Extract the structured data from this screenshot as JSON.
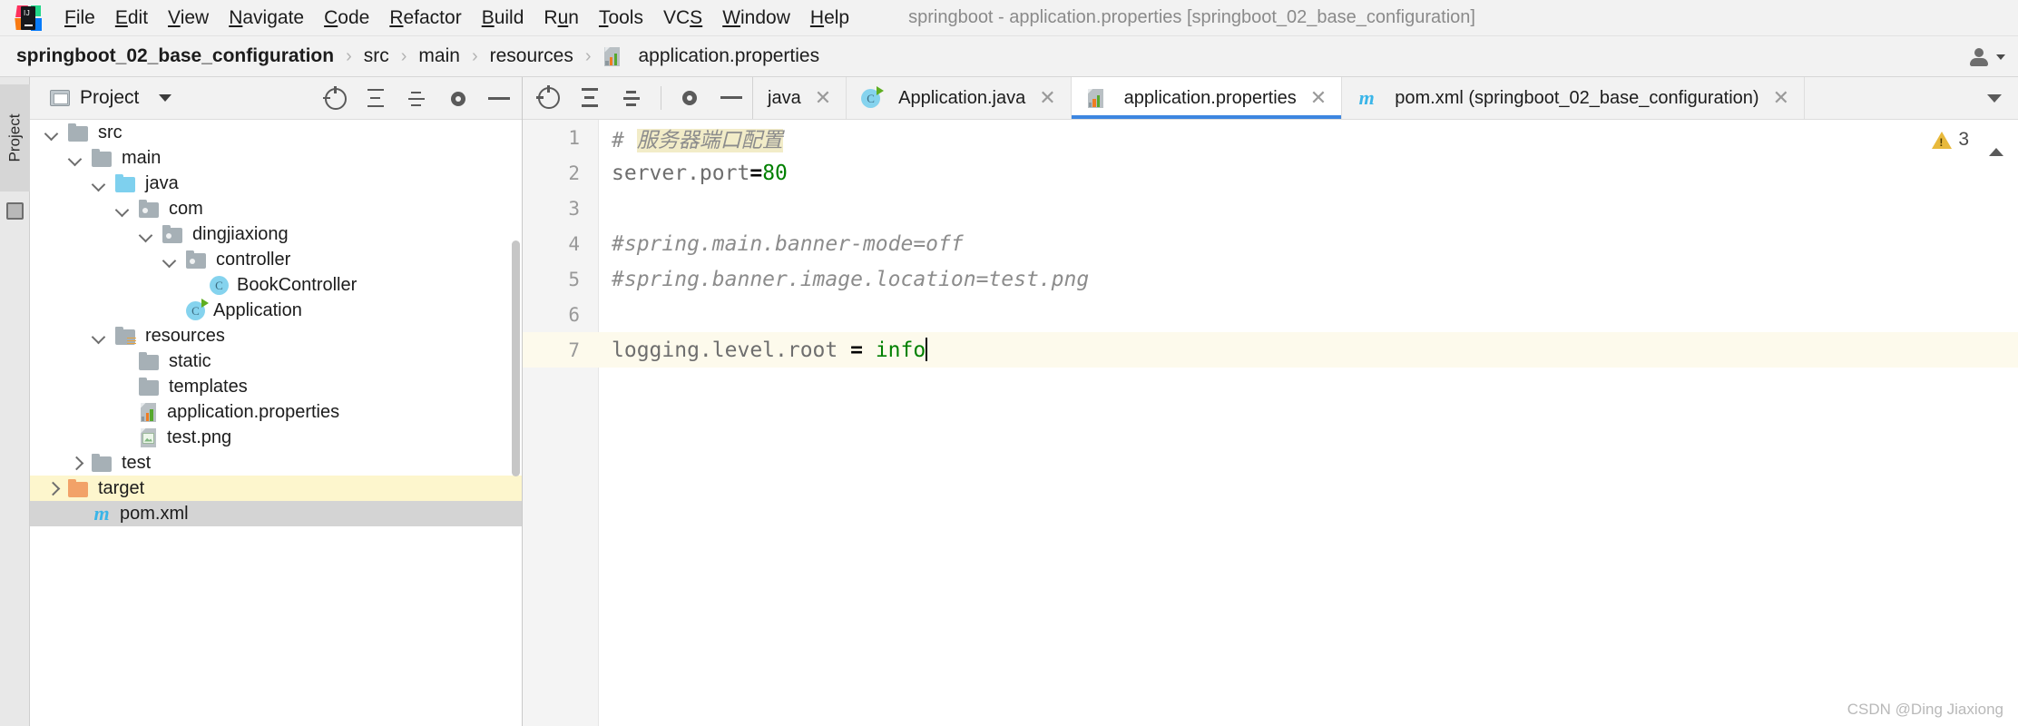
{
  "window": {
    "title": "springboot - application.properties [springboot_02_base_configuration]",
    "logo_name": "intellij-idea-logo"
  },
  "menubar": {
    "items": [
      {
        "label": "File",
        "mnemonic": "F"
      },
      {
        "label": "Edit",
        "mnemonic": "E"
      },
      {
        "label": "View",
        "mnemonic": "V"
      },
      {
        "label": "Navigate",
        "mnemonic": "N"
      },
      {
        "label": "Code",
        "mnemonic": "C"
      },
      {
        "label": "Refactor",
        "mnemonic": "R"
      },
      {
        "label": "Build",
        "mnemonic": "B"
      },
      {
        "label": "Run",
        "mnemonic": "u"
      },
      {
        "label": "Tools",
        "mnemonic": "T"
      },
      {
        "label": "VCS",
        "mnemonic": "S"
      },
      {
        "label": "Window",
        "mnemonic": "W"
      },
      {
        "label": "Help",
        "mnemonic": "H"
      }
    ]
  },
  "breadcrumb": {
    "separator": "›",
    "items": [
      {
        "label": "springboot_02_base_configuration",
        "icon": "none"
      },
      {
        "label": "src",
        "icon": "none"
      },
      {
        "label": "main",
        "icon": "none"
      },
      {
        "label": "resources",
        "icon": "none"
      },
      {
        "label": "application.properties",
        "icon": "properties-file-icon"
      }
    ]
  },
  "left_strip": {
    "tab_label": "Project"
  },
  "project_panel": {
    "title": "Project",
    "toolbar": [
      {
        "name": "locate-icon"
      },
      {
        "name": "expand-all-icon"
      },
      {
        "name": "collapse-all-icon"
      },
      {
        "name": "settings-gear-icon"
      },
      {
        "name": "hide-panel-icon"
      }
    ],
    "tree": [
      {
        "label": "src",
        "indent": 1,
        "arrow": "down",
        "icon": "folder-gray",
        "highlight": "none"
      },
      {
        "label": "main",
        "indent": 2,
        "arrow": "down",
        "icon": "folder-gray",
        "highlight": "none"
      },
      {
        "label": "java",
        "indent": 3,
        "arrow": "down",
        "icon": "folder-cyan",
        "highlight": "none"
      },
      {
        "label": "com",
        "indent": 4,
        "arrow": "down",
        "icon": "folder-package",
        "highlight": "none"
      },
      {
        "label": "dingjiaxiong",
        "indent": 5,
        "arrow": "down",
        "icon": "folder-package",
        "highlight": "none"
      },
      {
        "label": "controller",
        "indent": 6,
        "arrow": "down",
        "icon": "folder-package",
        "highlight": "none"
      },
      {
        "label": "BookController",
        "indent": 7,
        "arrow": "none",
        "icon": "java-class",
        "highlight": "none"
      },
      {
        "label": "Application",
        "indent": 6,
        "arrow": "none",
        "icon": "java-class-run",
        "highlight": "none"
      },
      {
        "label": "resources",
        "indent": 3,
        "arrow": "down",
        "icon": "folder-resources",
        "highlight": "none"
      },
      {
        "label": "static",
        "indent": 4,
        "arrow": "none",
        "icon": "folder-gray",
        "highlight": "none"
      },
      {
        "label": "templates",
        "indent": 4,
        "arrow": "none",
        "icon": "folder-gray",
        "highlight": "none"
      },
      {
        "label": "application.properties",
        "indent": 4,
        "arrow": "none",
        "icon": "properties-file",
        "highlight": "none"
      },
      {
        "label": "test.png",
        "indent": 4,
        "arrow": "none",
        "icon": "png-file",
        "highlight": "none"
      },
      {
        "label": "test",
        "indent": 2,
        "arrow": "right",
        "icon": "folder-gray",
        "highlight": "none"
      },
      {
        "label": "target",
        "indent": 1,
        "arrow": "right",
        "icon": "folder-orange",
        "highlight": "yellow"
      },
      {
        "label": "pom.xml",
        "indent": 2,
        "arrow": "none",
        "icon": "maven-file",
        "highlight": "gray"
      }
    ]
  },
  "editor": {
    "tabs": [
      {
        "label": "java",
        "icon": "none",
        "active": false,
        "closable": true
      },
      {
        "label": "Application.java",
        "icon": "java-class-run",
        "active": false,
        "closable": true
      },
      {
        "label": "application.properties",
        "icon": "properties-file",
        "active": true,
        "closable": true
      },
      {
        "label": "pom.xml (springboot_02_base_configuration)",
        "icon": "maven-file",
        "active": false,
        "closable": true
      }
    ],
    "warning_count": "3",
    "lines": [
      {
        "num": "1",
        "segments": [
          {
            "text": "# ",
            "style": "comment"
          },
          {
            "text": "服务器端口配置",
            "style": "comment-highlight"
          }
        ],
        "current": false
      },
      {
        "num": "2",
        "segments": [
          {
            "text": "server.port",
            "style": "key"
          },
          {
            "text": "=",
            "style": "equals"
          },
          {
            "text": "80",
            "style": "value"
          }
        ],
        "current": false
      },
      {
        "num": "3",
        "segments": [],
        "current": false
      },
      {
        "num": "4",
        "segments": [
          {
            "text": "#spring.main.banner-mode=off",
            "style": "comment"
          }
        ],
        "current": false
      },
      {
        "num": "5",
        "segments": [
          {
            "text": "#spring.banner.image.location=test.png",
            "style": "comment"
          }
        ],
        "current": false
      },
      {
        "num": "6",
        "segments": [],
        "current": false
      },
      {
        "num": "7",
        "segments": [
          {
            "text": "logging.level.root ",
            "style": "key"
          },
          {
            "text": "= ",
            "style": "equals"
          },
          {
            "text": "info",
            "style": "value"
          },
          {
            "text": "",
            "style": "caret"
          }
        ],
        "current": true
      }
    ]
  },
  "watermark": "CSDN @Ding Jiaxiong",
  "colors": {
    "accent_tab": "#3d86e0",
    "current_line": "#fdfaec",
    "tree_selection": "#d4d4d4",
    "tree_highlight": "#fdf6cd",
    "value_green": "#008000",
    "comment_gray": "#8c8c8c",
    "warning_yellow": "#e8b93b"
  }
}
